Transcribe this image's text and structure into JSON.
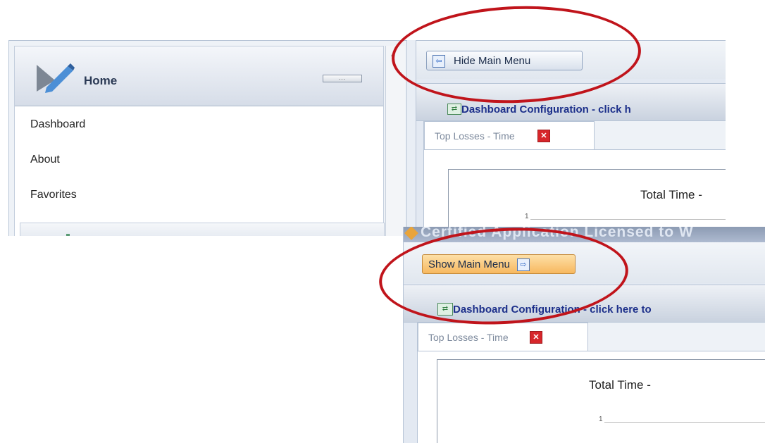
{
  "top_view": {
    "sidebar": {
      "header_title": "Home",
      "collapse_glyph": "...",
      "items": [
        {
          "label": "Dashboard"
        },
        {
          "label": "About"
        },
        {
          "label": "Favorites"
        }
      ],
      "scroll_glyph": "^"
    },
    "toolbar": {
      "button_label": "Hide Main Menu",
      "button_icon": "arrow-left-icon"
    },
    "dashboard_bar": {
      "text": "Dashboard Configuration - click h"
    },
    "tab": {
      "label": "Top Losses - Time",
      "close_glyph": "✕"
    },
    "chart": {
      "title": "Total Time -",
      "tick": "1"
    }
  },
  "bottom_view": {
    "license_text": "Certified Application Licensed to W",
    "toolbar": {
      "button_label": "Show Main Menu",
      "button_icon": "arrow-right-icon"
    },
    "dashboard_bar": {
      "text": "Dashboard Configuration - click here to"
    },
    "tab": {
      "label": "Top Losses - Time",
      "close_glyph": "✕"
    },
    "chart": {
      "title": "Total Time -",
      "tick": "1"
    }
  },
  "colors": {
    "annotation": "#c0141b",
    "show_button": "#f7b85f",
    "dashboard_text": "#1c2f8a"
  }
}
